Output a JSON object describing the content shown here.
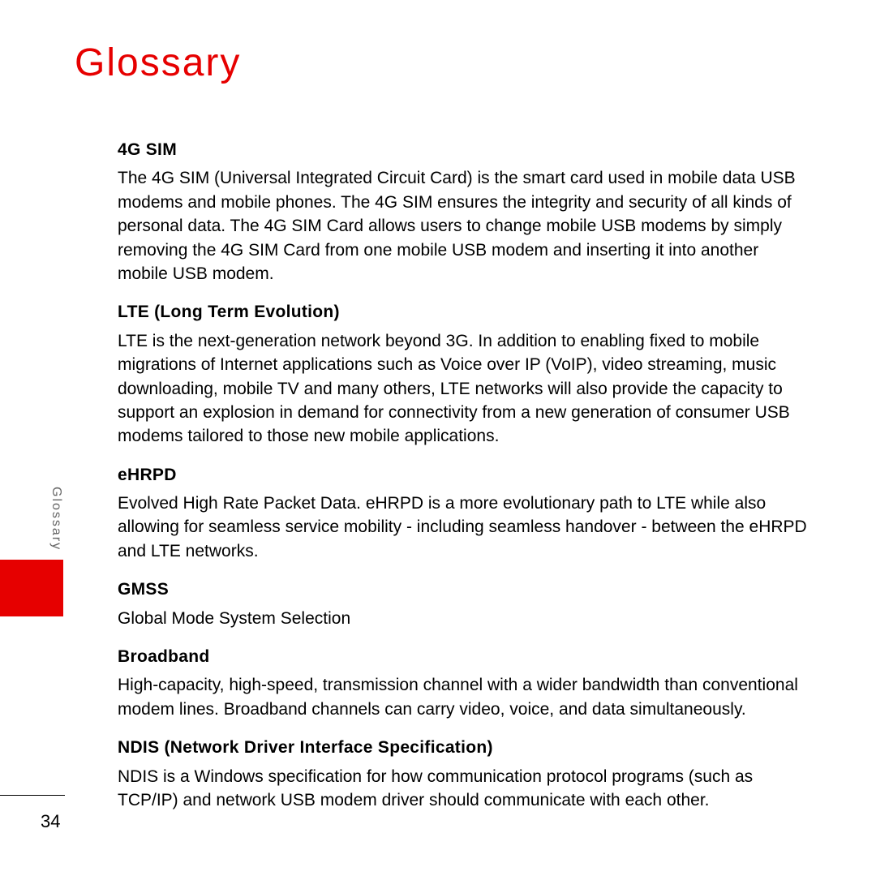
{
  "page": {
    "title": "Glossary",
    "side_tab": "Glossary",
    "number": "34"
  },
  "entries": [
    {
      "term": "4G SIM",
      "def": "The 4G SIM (Universal Integrated Circuit Card) is the smart card used in mobile data USB modems and mobile phones. The 4G SIM ensures the integrity and security of all kinds of personal data. The 4G SIM Card allows users to change mobile USB modems by simply removing the 4G SIM Card from one mobile USB modem and inserting it into another mobile USB modem."
    },
    {
      "term": "LTE (Long Term Evolution)",
      "def": "LTE is the next-generation network beyond 3G. In addition to enabling fixed to mobile migrations of Internet applications such as Voice over IP (VoIP), video streaming, music downloading, mobile TV and many others, LTE networks will also provide the capacity to support an explosion in demand for connectivity from a new generation of consumer USB modems tailored to those new mobile applications."
    },
    {
      "term": "eHRPD",
      "def": "Evolved High Rate Packet Data. eHRPD is a more evolutionary path to LTE while also allowing for seamless service mobility - including seamless handover - between the eHRPD and LTE networks."
    },
    {
      "term": "GMSS",
      "def": "Global Mode System Selection"
    },
    {
      "term": "Broadband",
      "def": "High-capacity, high-speed, transmission channel with a wider bandwidth than conventional modem lines. Broadband channels can carry video, voice, and data simultaneously."
    },
    {
      "term": "NDIS (Network Driver Interface Specification)",
      "def": "NDIS is a Windows specification for how communication protocol programs (such as TCP/IP) and network USB modem driver should communicate with each other."
    }
  ]
}
